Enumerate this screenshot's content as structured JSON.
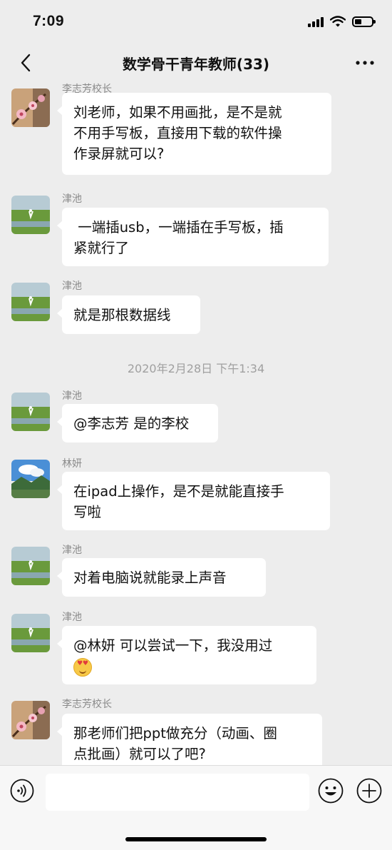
{
  "status_bar": {
    "time": "7:09"
  },
  "header": {
    "title": "数学骨干青年教师(33)"
  },
  "timestamp": "2020年2月28日 下午1:34",
  "messages": [
    {
      "sender": "李志芳校长",
      "text_lines": [
        "刘老师，如果不用画批，是不是就",
        "不用手写板，直接用下载的软件操",
        "作录屏就可以?"
      ],
      "avatar": "plum-blossom"
    },
    {
      "sender": "津池",
      "text_lines": [
        " 一端插usb，一端插在手写板，插",
        "紧就行了"
      ],
      "avatar": "grassland-egret"
    },
    {
      "sender": "津池",
      "text_lines": [
        "就是那根数据线"
      ],
      "avatar": "grassland-egret"
    },
    {
      "sender": "津池",
      "text_lines": [
        "@李志芳 是的李校"
      ],
      "avatar": "grassland-egret"
    },
    {
      "sender": "林妍",
      "text_lines": [
        "在ipad上操作，是不是就能直接手",
        "写啦"
      ],
      "avatar": "sky-mountain"
    },
    {
      "sender": "津池",
      "text_lines": [
        "对着电脑说就能录上声音"
      ],
      "avatar": "grassland-egret"
    },
    {
      "sender": "津池",
      "text_lines": [
        "@林妍 可以尝试一下，我没用过"
      ],
      "emoji": "heart-eyes-emoji",
      "avatar": "grassland-egret"
    },
    {
      "sender": "李志芳校长",
      "text_lines": [
        "那老师们把ppt做充分（动画、圈",
        "点批画）就可以了吧?"
      ],
      "avatar": "plum-blossom"
    }
  ],
  "input_bar": {
    "placeholder": ""
  },
  "icons": {
    "back": "chevron-left-icon",
    "more": "more-dots-icon",
    "voice": "voice-icon",
    "emoji": "emoji-icon",
    "plus": "plus-icon"
  },
  "colors": {
    "background": "#ededed",
    "bubble": "#ffffff",
    "sender": "#8a8a8a"
  }
}
